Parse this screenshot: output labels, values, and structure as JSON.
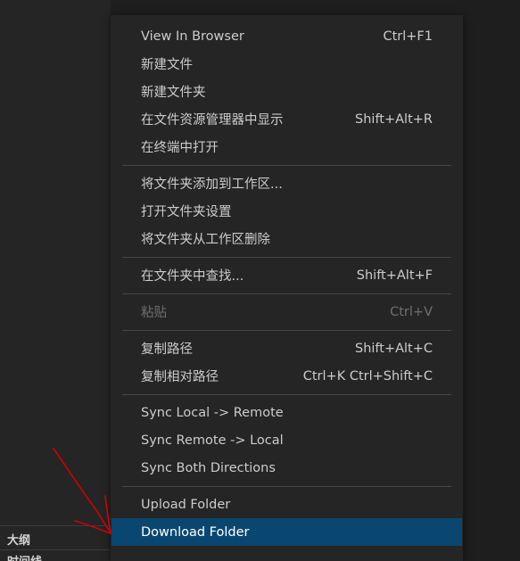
{
  "sidebar": {
    "outline_label": "大纲",
    "timeline_label": "时间线"
  },
  "menu": {
    "groups": [
      [
        {
          "label": "View In Browser",
          "shortcut": "Ctrl+F1"
        },
        {
          "label": "新建文件",
          "shortcut": ""
        },
        {
          "label": "新建文件夹",
          "shortcut": ""
        },
        {
          "label": "在文件资源管理器中显示",
          "shortcut": "Shift+Alt+R"
        },
        {
          "label": "在终端中打开",
          "shortcut": ""
        }
      ],
      [
        {
          "label": "将文件夹添加到工作区...",
          "shortcut": ""
        },
        {
          "label": "打开文件夹设置",
          "shortcut": ""
        },
        {
          "label": "将文件夹从工作区删除",
          "shortcut": ""
        }
      ],
      [
        {
          "label": "在文件夹中查找...",
          "shortcut": "Shift+Alt+F"
        }
      ],
      [
        {
          "label": "粘贴",
          "shortcut": "Ctrl+V"
        }
      ],
      [
        {
          "label": "复制路径",
          "shortcut": "Shift+Alt+C"
        },
        {
          "label": "复制相对路径",
          "shortcut": "Ctrl+K Ctrl+Shift+C"
        }
      ],
      [
        {
          "label": "Sync Local -> Remote",
          "shortcut": ""
        },
        {
          "label": "Sync Remote -> Local",
          "shortcut": ""
        },
        {
          "label": "Sync Both Directions",
          "shortcut": ""
        }
      ],
      [
        {
          "label": "Upload Folder",
          "shortcut": ""
        },
        {
          "label": "Download Folder",
          "shortcut": ""
        }
      ]
    ]
  },
  "colors": {
    "menu_bg": "#252526",
    "highlight": "#094771",
    "text": "#cccccc",
    "disabled_text": "#6f6f6f",
    "annotation": "#d10000"
  }
}
